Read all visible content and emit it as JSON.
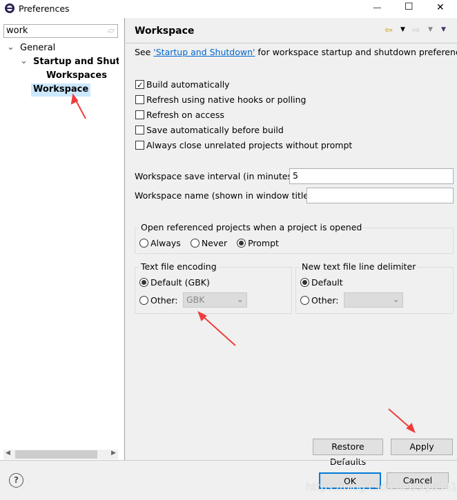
{
  "window": {
    "title": "Preferences",
    "minimize": "—",
    "maximize": "☐",
    "close": "✕"
  },
  "sidebar": {
    "search_value": "work",
    "tree": [
      {
        "label": "General"
      },
      {
        "label": "Startup and Shutdown"
      },
      {
        "label": "Workspaces"
      },
      {
        "label": "Workspace",
        "selected": true
      }
    ]
  },
  "page": {
    "title": "Workspace",
    "see_prefix": "See ",
    "see_link": "'Startup and Shutdown'",
    "see_suffix": " for workspace startup and shutdown preferences.",
    "checkboxes": [
      {
        "label": "Build automatically",
        "checked": true
      },
      {
        "label": "Refresh using native hooks or polling",
        "checked": false
      },
      {
        "label": "Refresh on access",
        "checked": false
      },
      {
        "label": "Save automatically before build",
        "checked": false
      },
      {
        "label": "Always close unrelated projects without prompt",
        "checked": false
      }
    ],
    "save_interval_label": "Workspace save interval (in minutes):",
    "save_interval_value": "5",
    "name_label": "Workspace name (shown in window title):",
    "name_value": "",
    "open_ref_group": {
      "title": "Open referenced projects when a project is opened",
      "options": [
        "Always",
        "Never",
        "Prompt"
      ],
      "selected": "Prompt"
    },
    "encoding_group": {
      "title": "Text file encoding",
      "default": "Default (GBK)",
      "other": "Other:",
      "other_value": "GBK",
      "selected": "default"
    },
    "delimiter_group": {
      "title": "New text file line delimiter",
      "default": "Default",
      "other": "Other:",
      "other_value": "",
      "selected": "default"
    },
    "restore_defaults": "Restore Defaults",
    "apply": "Apply"
  },
  "footer": {
    "ok": "OK",
    "cancel": "Cancel",
    "help": "?"
  },
  "watermark": "https://blog.csdn.net/siyu9412",
  "colors": {
    "selection": "#cce8ff",
    "link": "#0066cc",
    "annotation_arrow": "#f03c3c",
    "ok_border": "#0078d7"
  }
}
